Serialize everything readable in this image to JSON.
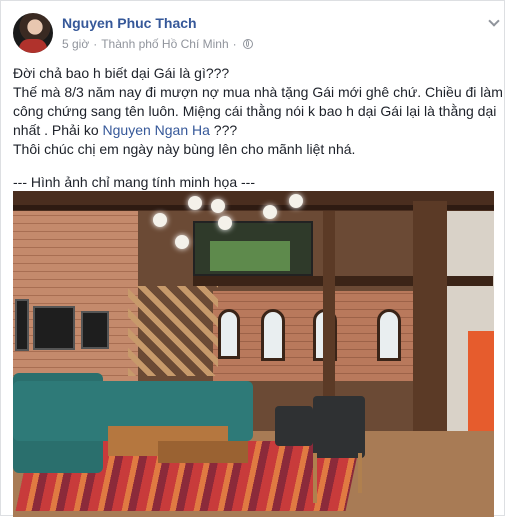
{
  "post": {
    "author": "Nguyen Phuc Thach",
    "time": "5 giờ",
    "separator": "·",
    "location": "Thành phố Hồ Chí Minh",
    "separator2": "·",
    "lines": [
      "Đời chả bao h biết dại Gái là gì???",
      "Thế mà 8/3 năm nay đi mượn nợ mua nhà tặng Gái mới ghê chứ. Chiều đi làm",
      "công chứng sang tên luôn. Miệng cái thằng nói k bao h dại Gái lại là thằng dại"
    ],
    "line4_before": "nhất . Phải ko ",
    "mention": "Nguyen Ngan Ha",
    "line4_after": " ???",
    "line5": "Thôi chúc chị em ngày này bùng lên cho mãnh liệt nhá.",
    "caption": "--- Hình ảnh chỉ mang tính minh họa ---"
  },
  "icons": {
    "privacy": "globe-icon",
    "menu": "chevron-down-icon"
  },
  "colors": {
    "author_link": "#365899",
    "meta_text": "#90949c",
    "body_text": "#1d2129"
  }
}
